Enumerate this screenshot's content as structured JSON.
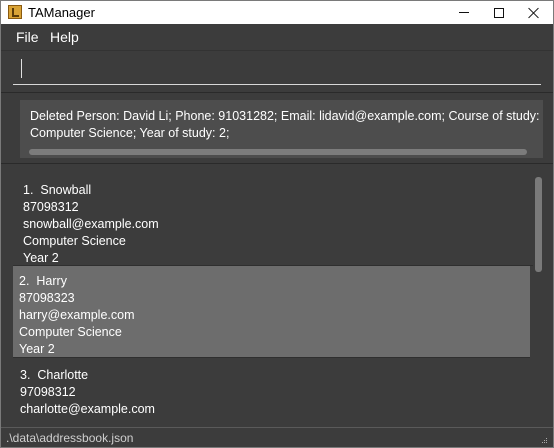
{
  "window": {
    "title": "TAManager"
  },
  "menu": {
    "file": "File",
    "help": "Help"
  },
  "command": {
    "value": "",
    "placeholder": ""
  },
  "result": {
    "line1": "Deleted Person: David Li; Phone: 91031282; Email: lidavid@example.com; Course of study:",
    "line2": "Computer Science; Year of study: 2;"
  },
  "persons": [
    {
      "index": "1.",
      "name": "Snowball",
      "phone": "87098312",
      "email": "snowball@example.com",
      "course": "Computer Science",
      "year": "Year 2"
    },
    {
      "index": "2.",
      "name": "Harry",
      "phone": "87098323",
      "email": "harry@example.com",
      "course": "Computer Science",
      "year": "Year 2"
    },
    {
      "index": "3.",
      "name": "Charlotte",
      "phone": "97098312",
      "email": "charlotte@example.com",
      "course": "",
      "year": ""
    }
  ],
  "status": {
    "path": ".\\data\\addressbook.json"
  }
}
